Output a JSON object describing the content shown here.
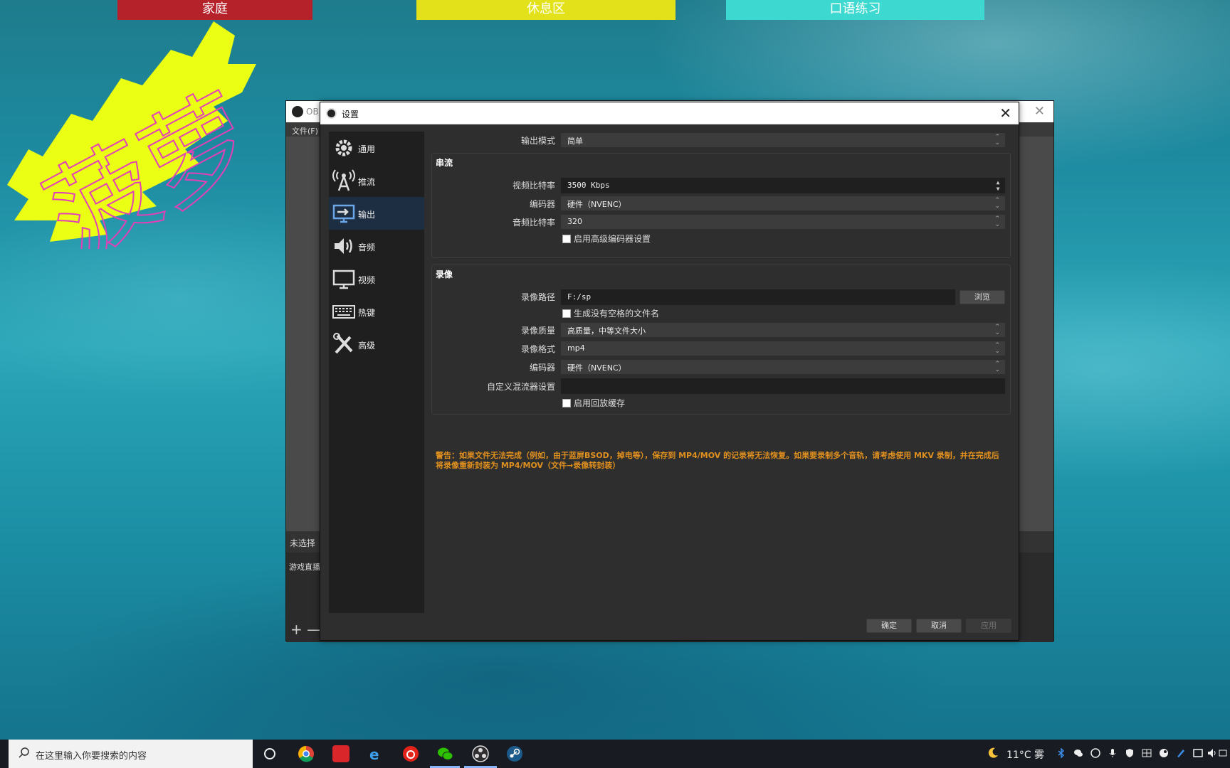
{
  "desktop": {
    "tabs": [
      "家庭",
      "休息区",
      "口语练习"
    ],
    "tab_colors": [
      "#b5222a",
      "#e3e21a",
      "#3dd8cf"
    ],
    "sticker_text": "菠萝"
  },
  "obs_main": {
    "title": "OB",
    "menu": "文件(F)",
    "scene_header": "未选择",
    "scene_item": "游戏直播",
    "add": "+",
    "remove": "—"
  },
  "settings": {
    "title": "设置",
    "close": "✕",
    "nav": [
      {
        "label": "通用",
        "icon": "gear-icon"
      },
      {
        "label": "推流",
        "icon": "broadcast-tower-icon"
      },
      {
        "label": "输出",
        "icon": "output-monitor-icon"
      },
      {
        "label": "音频",
        "icon": "speaker-icon"
      },
      {
        "label": "视频",
        "icon": "monitor-icon"
      },
      {
        "label": "热键",
        "icon": "keyboard-icon"
      },
      {
        "label": "高级",
        "icon": "tools-icon"
      }
    ],
    "active_nav": "输出",
    "output_mode_label": "输出模式",
    "output_mode_value": "简单",
    "streaming": {
      "title": "串流",
      "video_bitrate_label": "视频比特率",
      "video_bitrate_value": "3500 Kbps",
      "encoder_label": "编码器",
      "encoder_value": "硬件（NVENC）",
      "audio_bitrate_label": "音频比特率",
      "audio_bitrate_value": "320",
      "advanced_encoder_check": "启用高级编码器设置"
    },
    "recording": {
      "title": "录像",
      "path_label": "录像路径",
      "path_value": "F:/sp",
      "browse": "浏览",
      "no_space_check": "生成没有空格的文件名",
      "quality_label": "录像质量",
      "quality_value": "高质量，中等文件大小",
      "format_label": "录像格式",
      "format_value": "mp4",
      "encoder_label": "编码器",
      "encoder_value": "硬件（NVENC）",
      "muxer_label": "自定义混流器设置",
      "muxer_value": "",
      "replay_check": "启用回放缓存"
    },
    "warning": "警告：如果文件无法完成（例如，由于蓝屏BSOD，掉电等），保存到 MP4/MOV 的记录将无法恢复。如果要录制多个音轨，请考虑使用 MKV 录制，并在完成后将录像重新封装为 MP4/MOV（文件→录像转封装）",
    "buttons": {
      "ok": "确定",
      "cancel": "取消",
      "apply": "应用"
    }
  },
  "taskbar": {
    "search_placeholder": "在这里输入你要搜索的内容",
    "weather": "11°C 雾"
  }
}
